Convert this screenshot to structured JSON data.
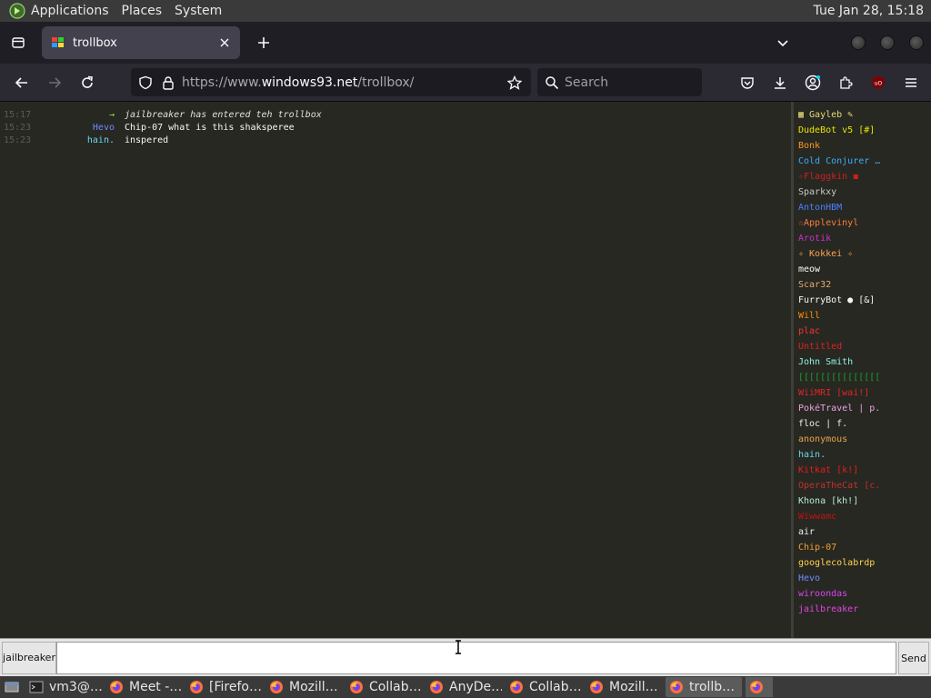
{
  "top_panel": {
    "menus": [
      "Applications",
      "Places",
      "System"
    ],
    "clock": "Tue Jan 28, 15:18"
  },
  "browser": {
    "tab_title": "trollbox",
    "url_prefix": "https://www.",
    "url_host": "windows93.net",
    "url_path": "/trollbox/",
    "search_placeholder": "Search"
  },
  "chat": {
    "messages": [
      {
        "time": "15:17",
        "nick": "→",
        "text": "jailbreaker has entered teh trollbox",
        "nick_color": "#a6e22e",
        "text_color": "#e0e0e0"
      },
      {
        "time": "15:23",
        "nick": "Hevo",
        "text": "Chip-07 what is this shaksperee",
        "nick_color": "#6b8cff",
        "text_color": "#f8f8f2"
      },
      {
        "time": "15:23",
        "nick": "hain.",
        "text": "inspered",
        "nick_color": "#66d9ef",
        "text_color": "#f8f8f2"
      }
    ],
    "users": [
      {
        "name": "▦ Gayleb ✎",
        "color": "#e6db74"
      },
      {
        "name": "DudeBot v5 [#]",
        "color": "#e6e600"
      },
      {
        "name": "Bonk",
        "color": "#fd971f"
      },
      {
        "name": "Cold Conjurer …",
        "color": "#3ea8ff"
      },
      {
        "name": "✧Flaggkin ◼",
        "color": "#d01e1e"
      },
      {
        "name": "Sparkxy",
        "color": "#c8c8c8"
      },
      {
        "name": "AntonHBM",
        "color": "#4f7fff"
      },
      {
        "name": "☆Applevinyl",
        "color": "#ff7b3b"
      },
      {
        "name": "Arotik",
        "color": "#c930c9"
      },
      {
        "name": "✧ Kokkei ✧",
        "color": "#ffa54f"
      },
      {
        "name": "meow",
        "color": "#f8f8f2"
      },
      {
        "name": "Scar32",
        "color": "#e6a96b"
      },
      {
        "name": "FurryBot ● [&]",
        "color": "#f8f8f2"
      },
      {
        "name": "Will",
        "color": "#ff8c00"
      },
      {
        "name": "plac",
        "color": "#ff3030"
      },
      {
        "name": "Untitled",
        "color": "#e02020"
      },
      {
        "name": "John Smith",
        "color": "#8ff0e0"
      },
      {
        "name": "[[[[[[[[[[[[[[[",
        "color": "#1e9b2e"
      },
      {
        "name": "WiiMRI [wai!]",
        "color": "#e52525"
      },
      {
        "name": "PokéTravel | p.",
        "color": "#f0a0e0"
      },
      {
        "name": "floc | f.",
        "color": "#f0f0f0"
      },
      {
        "name": "anonymous",
        "color": "#e8a54a"
      },
      {
        "name": "hain.",
        "color": "#66d9ef"
      },
      {
        "name": "Kitkat [k!]",
        "color": "#e81c1c"
      },
      {
        "name": "OperaTheCat [c.",
        "color": "#c23030"
      },
      {
        "name": "Khona [kh!]",
        "color": "#b6e9d6"
      },
      {
        "name": "Wiwwamc",
        "color": "#c81010"
      },
      {
        "name": "air",
        "color": "#f0f0f0"
      },
      {
        "name": "Chip-07",
        "color": "#f0a030"
      },
      {
        "name": "googlecolabrdp",
        "color": "#ffd24a"
      },
      {
        "name": "Hevo",
        "color": "#6b8cff"
      },
      {
        "name": "wiroondas",
        "color": "#d946ef"
      },
      {
        "name": "jailbreaker",
        "color": "#e045e0"
      }
    ],
    "nick_button": "jailbreaker",
    "send_button": "Send",
    "input_value": ""
  },
  "taskbar": {
    "tasks": [
      {
        "label": "vm3@…",
        "icon": "terminal-icon",
        "active": false
      },
      {
        "label": "Meet -…",
        "icon": "firefox-icon",
        "active": false
      },
      {
        "label": "[Firefo…",
        "icon": "firefox-icon",
        "active": false
      },
      {
        "label": "Mozill…",
        "icon": "firefox-icon",
        "active": false
      },
      {
        "label": "Collab…",
        "icon": "firefox-icon",
        "active": false
      },
      {
        "label": "AnyDe…",
        "icon": "firefox-icon",
        "active": false
      },
      {
        "label": "Collab…",
        "icon": "firefox-icon",
        "active": false
      },
      {
        "label": "Mozill…",
        "icon": "firefox-icon",
        "active": false
      },
      {
        "label": "trollb…",
        "icon": "firefox-icon",
        "active": true
      },
      {
        "label": "",
        "icon": "firefox-icon",
        "active": false
      }
    ]
  }
}
